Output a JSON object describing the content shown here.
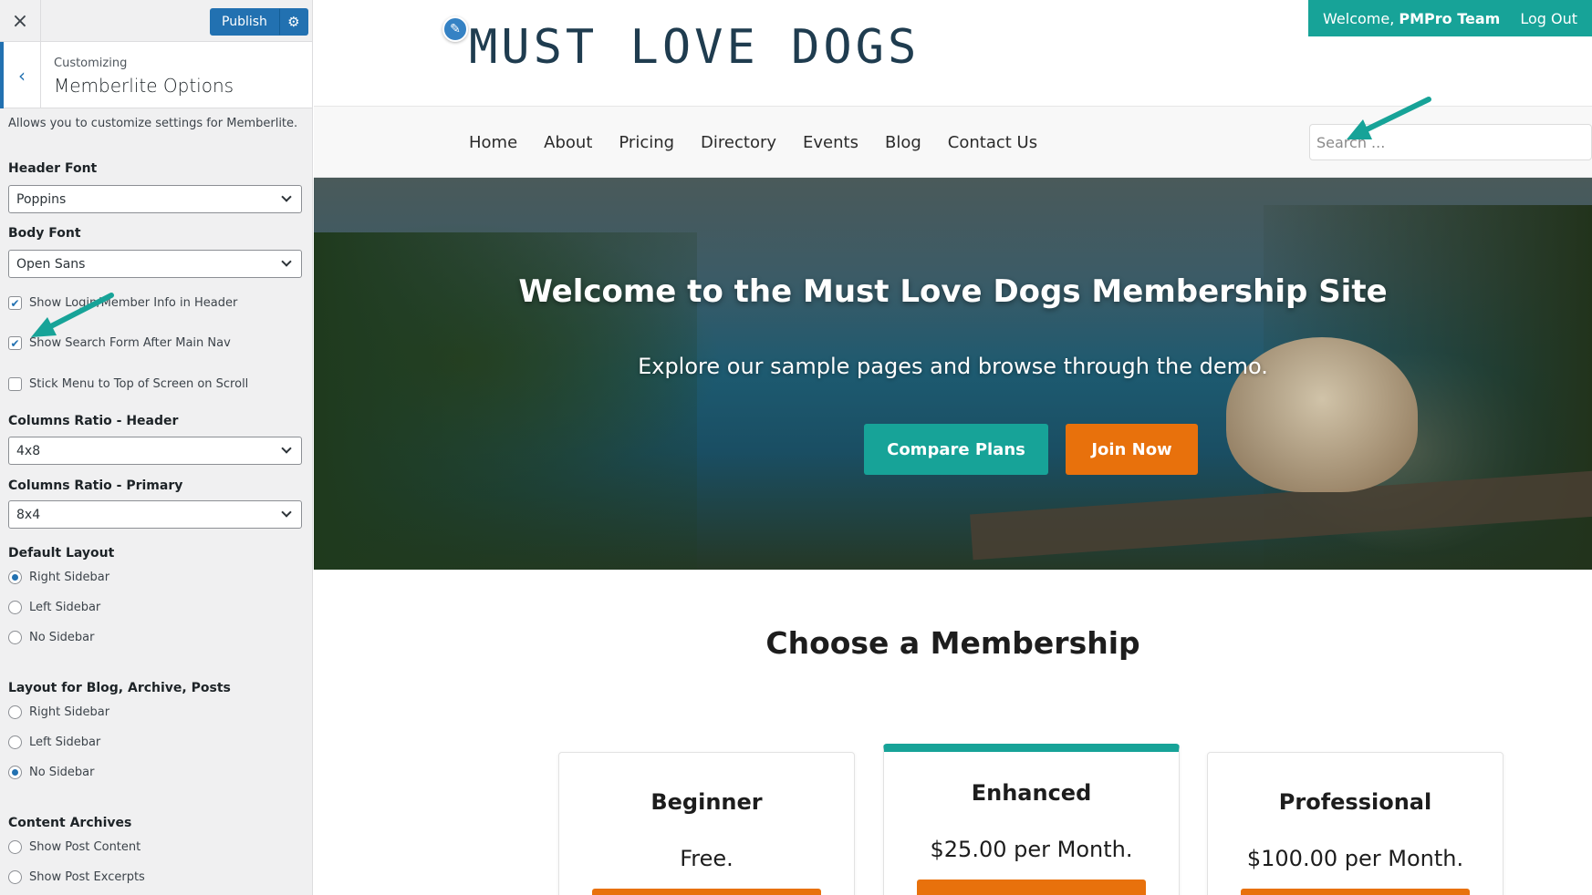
{
  "customizer": {
    "close_label": "×",
    "publish_label": "Publish",
    "subtitle": "Customizing",
    "title": "Memberlite Options",
    "description": "Allows you to customize settings for Memberlite.",
    "header_font": {
      "label": "Header Font",
      "value": "Poppins"
    },
    "body_font": {
      "label": "Body Font",
      "value": "Open Sans"
    },
    "checkboxes": [
      {
        "label": "Show Login/Member Info in Header",
        "checked": true
      },
      {
        "label": "Show Search Form After Main Nav",
        "checked": true
      },
      {
        "label": "Stick Menu to Top of Screen on Scroll",
        "checked": false
      }
    ],
    "columns_header": {
      "label": "Columns Ratio - Header",
      "value": "4x8"
    },
    "columns_primary": {
      "label": "Columns Ratio - Primary",
      "value": "8x4"
    },
    "default_layout": {
      "label": "Default Layout",
      "options": [
        {
          "label": "Right Sidebar",
          "selected": true
        },
        {
          "label": "Left Sidebar",
          "selected": false
        },
        {
          "label": "No Sidebar",
          "selected": false
        }
      ]
    },
    "blog_layout": {
      "label": "Layout for Blog, Archive, Posts",
      "options": [
        {
          "label": "Right Sidebar",
          "selected": false
        },
        {
          "label": "Left Sidebar",
          "selected": false
        },
        {
          "label": "No Sidebar",
          "selected": true
        }
      ]
    },
    "content_archives": {
      "label": "Content Archives",
      "options": [
        {
          "label": "Show Post Content",
          "selected": false
        },
        {
          "label": "Show Post Excerpts",
          "selected": false
        }
      ]
    }
  },
  "site": {
    "logo_text": "MUST LOVE DOGS",
    "welcome_prefix": "Welcome, ",
    "welcome_name": "PMPro Team",
    "logout_label": "Log Out",
    "nav": [
      "Home",
      "About",
      "Pricing",
      "Directory",
      "Events",
      "Blog",
      "Contact Us"
    ],
    "search_placeholder": "Search ...",
    "hero_title": "Welcome to the Must Love Dogs Membership Site",
    "hero_subtitle": "Explore our sample pages and browse through the demo.",
    "compare_label": "Compare Plans",
    "join_label": "Join Now",
    "section_title": "Choose a Membership",
    "plans": [
      {
        "name": "Beginner",
        "price": "Free."
      },
      {
        "name": "Enhanced",
        "price": "$25.00 per Month."
      },
      {
        "name": "Professional",
        "price": "$100.00 per Month."
      }
    ]
  },
  "colors": {
    "accent_teal": "#17a398",
    "accent_orange": "#e8710c",
    "wp_blue": "#2271b1"
  }
}
